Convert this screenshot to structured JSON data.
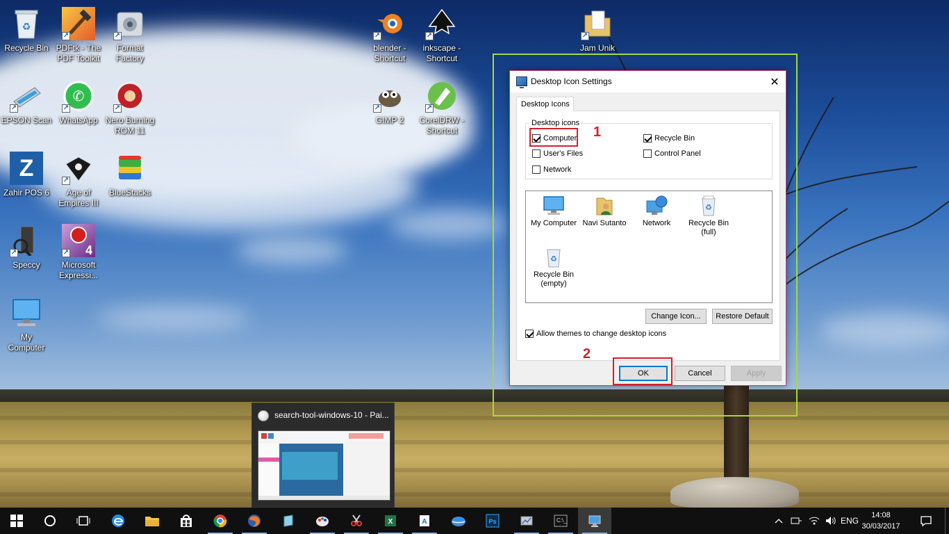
{
  "desktop": {
    "icons": [
      {
        "label": "Recycle Bin",
        "icon": "recycle-bin-icon"
      },
      {
        "label": "PDFtk - The\nPDF Toolkit",
        "icon": "pdftk-icon"
      },
      {
        "label": "Format\nFactory",
        "icon": "format-factory-icon"
      },
      {
        "label": "EPSON Scan",
        "icon": "epson-scan-icon"
      },
      {
        "label": "WhatsApp",
        "icon": "whatsapp-icon"
      },
      {
        "label": "Nero Burning\nROM 11",
        "icon": "nero-icon"
      },
      {
        "label": "Zahir POS 6",
        "icon": "zahir-icon"
      },
      {
        "label": "Age of\nEmpires III",
        "icon": "age-of-empires-icon"
      },
      {
        "label": "BlueStacks",
        "icon": "bluestacks-icon"
      },
      {
        "label": "Speccy",
        "icon": "speccy-icon"
      },
      {
        "label": "Microsoft\nExpressi...",
        "icon": "expression-icon"
      },
      {
        "label": "My\nComputer",
        "icon": "my-computer-icon"
      },
      {
        "label": "blender -\nShortcut",
        "icon": "blender-icon"
      },
      {
        "label": "inkscape -\nShortcut",
        "icon": "inkscape-icon"
      },
      {
        "label": "GIMP 2",
        "icon": "gimp-icon"
      },
      {
        "label": "CorelDRW -\nShortcut",
        "icon": "coreldraw-icon"
      },
      {
        "label": "Jam Unik",
        "icon": "folder-icon"
      }
    ]
  },
  "dialog": {
    "title": "Desktop Icon Settings",
    "close_label": "✕",
    "tab_label": "Desktop Icons",
    "group_label": "Desktop icons",
    "checkboxes": [
      {
        "label": "Computer",
        "checked": true
      },
      {
        "label": "User's Files",
        "checked": false
      },
      {
        "label": "Network",
        "checked": false
      },
      {
        "label": "Recycle Bin",
        "checked": true
      },
      {
        "label": "Control Panel",
        "checked": false
      }
    ],
    "icon_items": [
      {
        "label": "My Computer",
        "icon": "monitor-icon"
      },
      {
        "label": "Navi Sutanto",
        "icon": "user-folder-icon"
      },
      {
        "label": "Network",
        "icon": "network-icon"
      },
      {
        "label": "Recycle Bin\n(full)",
        "icon": "recycle-bin-full-icon"
      },
      {
        "label": "Recycle Bin\n(empty)",
        "icon": "recycle-bin-empty-icon"
      }
    ],
    "change_icon_label": "Change Icon...",
    "restore_default_label": "Restore Default",
    "allow_themes_label": "Allow themes to change desktop icons",
    "allow_themes_checked": true,
    "ok_label": "OK",
    "cancel_label": "Cancel",
    "apply_label": "Apply"
  },
  "annotations": {
    "step1": "1",
    "step2": "2",
    "highlight_color": "#d21f2b",
    "frame_color": "#a6d93d"
  },
  "preview": {
    "title": "search-tool-windows-10 - Pai..."
  },
  "taskbar": {
    "items": [
      "start-icon",
      "cortana-icon",
      "task-view-icon",
      "edge-icon",
      "file-explorer-icon",
      "store-icon",
      "chrome-icon",
      "firefox-icon",
      "app-icon",
      "paint-icon",
      "snipping-icon",
      "excel-icon",
      "app2-icon",
      "onedrive-icon",
      "photoshop-icon",
      "app3-icon",
      "cmd-icon",
      "display-settings-icon"
    ],
    "language": "ENG",
    "time": "14:08",
    "date": "30/03/2017"
  }
}
